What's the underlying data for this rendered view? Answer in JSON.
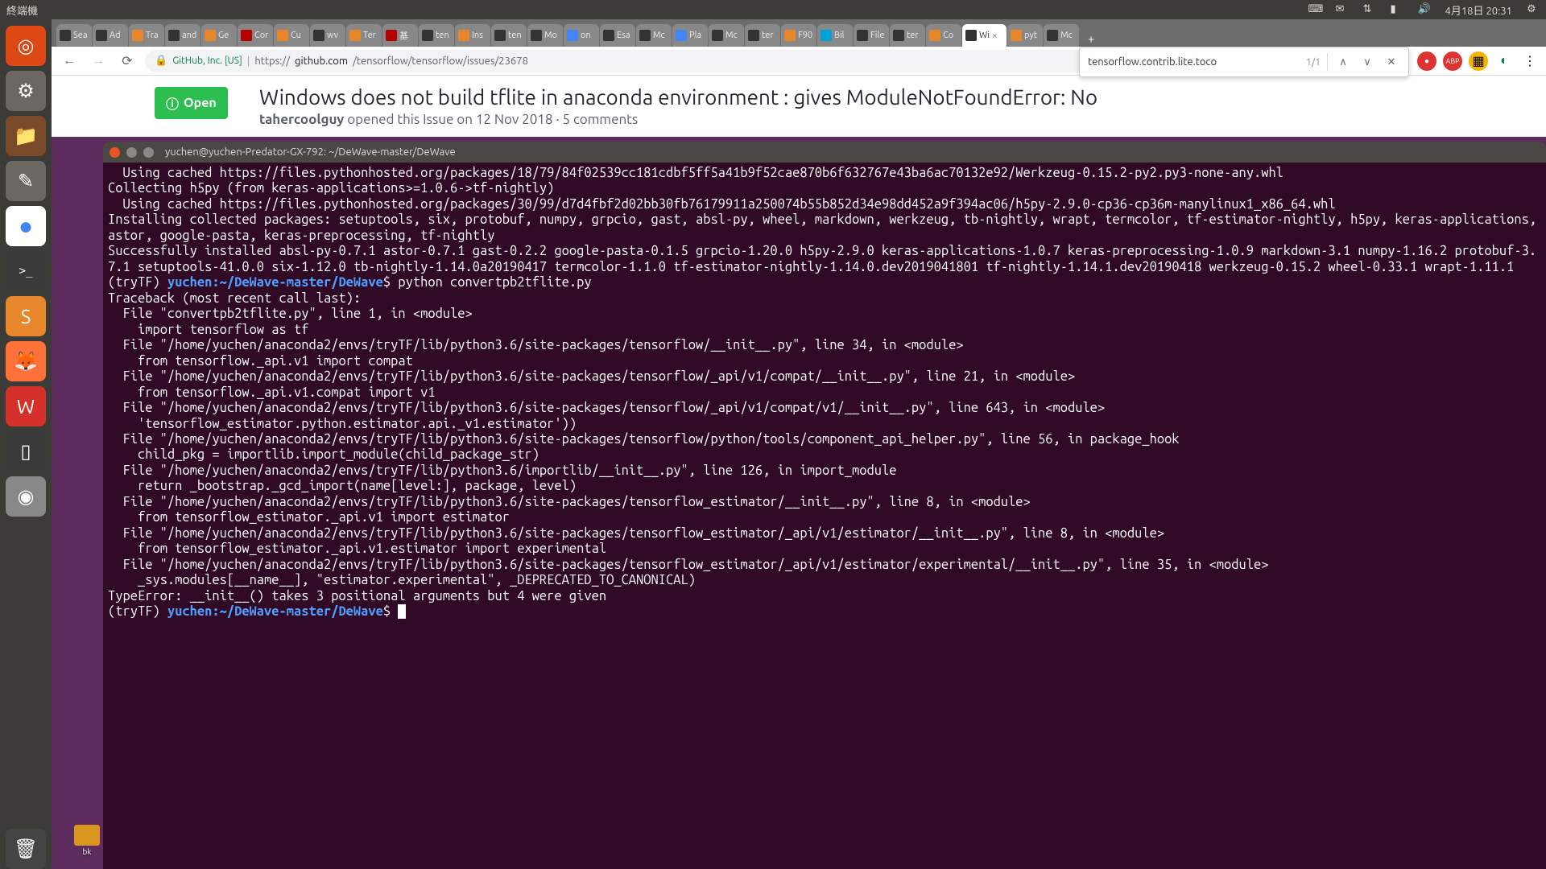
{
  "topbar": {
    "app_title": "終端機",
    "clock": "4月18日 20:31"
  },
  "launcher": {
    "items": [
      {
        "name": "dash",
        "glyph": "◎",
        "bg": "#dd4814"
      },
      {
        "name": "settings",
        "glyph": "⚙",
        "bg": "#6b6763"
      },
      {
        "name": "files",
        "glyph": "📁",
        "bg": "#7a4b2a"
      },
      {
        "name": "gedit",
        "glyph": "✎",
        "bg": "#6b6763"
      },
      {
        "name": "chrome",
        "glyph": "●",
        "bg": "#fff"
      },
      {
        "name": "terminal",
        "glyph": ">_",
        "bg": "#3a3a3a"
      },
      {
        "name": "sublime",
        "glyph": "S",
        "bg": "#e8862b"
      },
      {
        "name": "firefox",
        "glyph": "🦊",
        "bg": "#ff7139"
      },
      {
        "name": "wps",
        "glyph": "W",
        "bg": "#d6302a"
      },
      {
        "name": "device",
        "glyph": "▯",
        "bg": "#3a3a3a"
      },
      {
        "name": "disc",
        "glyph": "◉",
        "bg": "#888"
      }
    ],
    "trash_glyph": "🗑"
  },
  "chrome": {
    "tabs": [
      {
        "label": "Sea",
        "fav": "#333"
      },
      {
        "label": "Ad",
        "fav": "#333"
      },
      {
        "label": "Tra",
        "fav": "#e8862b"
      },
      {
        "label": "and",
        "fav": "#333"
      },
      {
        "label": "Ge",
        "fav": "#e8862b"
      },
      {
        "label": "Cor",
        "fav": "#b30000"
      },
      {
        "label": "Cu",
        "fav": "#e8862b"
      },
      {
        "label": "wv",
        "fav": "#333"
      },
      {
        "label": "Ter",
        "fav": "#e8862b"
      },
      {
        "label": "基",
        "fav": "#b30000"
      },
      {
        "label": "ten",
        "fav": "#333"
      },
      {
        "label": "Ins",
        "fav": "#e8862b"
      },
      {
        "label": "ten",
        "fav": "#333"
      },
      {
        "label": "Mo",
        "fav": "#333"
      },
      {
        "label": "on",
        "fav": "#4285f4"
      },
      {
        "label": "Esa",
        "fav": "#333"
      },
      {
        "label": "Mc",
        "fav": "#333"
      },
      {
        "label": "Pla",
        "fav": "#4285f4"
      },
      {
        "label": "Mc",
        "fav": "#333"
      },
      {
        "label": "ter",
        "fav": "#333"
      },
      {
        "label": "F90",
        "fav": "#e8862b"
      },
      {
        "label": "Bil",
        "fav": "#00a1d6"
      },
      {
        "label": "File",
        "fav": "#333"
      },
      {
        "label": "ter",
        "fav": "#333"
      },
      {
        "label": "Co",
        "fav": "#e8862b"
      },
      {
        "label": "Wi",
        "fav": "#333",
        "active": true
      },
      {
        "label": "pyt",
        "fav": "#e8862b"
      },
      {
        "label": "Mc",
        "fav": "#333"
      }
    ],
    "nav": {
      "back": "←",
      "fwd": "→",
      "reload": "⟳"
    },
    "omnibox": {
      "secure_label": "GitHub, Inc. [US]",
      "url_prefix": "https://",
      "url_host": "github.com",
      "url_path": "/tensorflow/tensorflow/issues/23678"
    },
    "find": {
      "query": "tensorflow.contrib.lite.toco",
      "count": "1/1"
    }
  },
  "github": {
    "status": "Open",
    "title": "Windows does not build tflite in anaconda environment : gives ModuleNotFoundError: No",
    "author": "tahercoolguy",
    "opened": " opened this Issue ",
    "date": "on 12 Nov 2018",
    "comments": " · 5 comments"
  },
  "terminal": {
    "title": "yuchen@yuchen-Predator-GX-792: ~/DeWave-master/DeWave",
    "prompt_env": "(tryTF) ",
    "prompt_userpath": "yuchen:~/DeWave-master/DeWave",
    "prompt_sep": "$ ",
    "cmd1": "python convertpb2tflite.py",
    "lines_pre": [
      "  Using cached https://files.pythonhosted.org/packages/18/79/84f02539cc181cdbf5ff5a41b9f52cae870b6f632767e43ba6ac70132e92/Werkzeug-0.15.2-py2.py3-none-any.whl",
      "Collecting h5py (from keras-applications>=1.0.6->tf-nightly)",
      "  Using cached https://files.pythonhosted.org/packages/30/99/d7d4fbf2d02bb30fb76179911a250074b55b852d34e98dd452a9f394ac06/h5py-2.9.0-cp36-cp36m-manylinux1_x86_64.whl",
      "Installing collected packages: setuptools, six, protobuf, numpy, grpcio, gast, absl-py, wheel, markdown, werkzeug, tb-nightly, wrapt, termcolor, tf-estimator-nightly, h5py, keras-applications, astor, google-pasta, keras-preprocessing, tf-nightly",
      "Successfully installed absl-py-0.7.1 astor-0.7.1 gast-0.2.2 google-pasta-0.1.5 grpcio-1.20.0 h5py-2.9.0 keras-applications-1.0.7 keras-preprocessing-1.0.9 markdown-3.1 numpy-1.16.2 protobuf-3.7.1 setuptools-41.0.0 six-1.12.0 tb-nightly-1.14.0a20190417 termcolor-1.1.0 tf-estimator-nightly-1.14.0.dev2019041801 tf-nightly-1.14.1.dev20190418 werkzeug-0.15.2 wheel-0.33.1 wrapt-1.11.1"
    ],
    "lines_post": [
      "Traceback (most recent call last):",
      "  File \"convertpb2tflite.py\", line 1, in <module>",
      "    import tensorflow as tf",
      "  File \"/home/yuchen/anaconda2/envs/tryTF/lib/python3.6/site-packages/tensorflow/__init__.py\", line 34, in <module>",
      "    from tensorflow._api.v1 import compat",
      "  File \"/home/yuchen/anaconda2/envs/tryTF/lib/python3.6/site-packages/tensorflow/_api/v1/compat/__init__.py\", line 21, in <module>",
      "    from tensorflow._api.v1.compat import v1",
      "  File \"/home/yuchen/anaconda2/envs/tryTF/lib/python3.6/site-packages/tensorflow/_api/v1/compat/v1/__init__.py\", line 643, in <module>",
      "    'tensorflow_estimator.python.estimator.api._v1.estimator'))",
      "  File \"/home/yuchen/anaconda2/envs/tryTF/lib/python3.6/site-packages/tensorflow/python/tools/component_api_helper.py\", line 56, in package_hook",
      "    child_pkg = importlib.import_module(child_package_str)",
      "  File \"/home/yuchen/anaconda2/envs/tryTF/lib/python3.6/importlib/__init__.py\", line 126, in import_module",
      "    return _bootstrap._gcd_import(name[level:], package, level)",
      "  File \"/home/yuchen/anaconda2/envs/tryTF/lib/python3.6/site-packages/tensorflow_estimator/__init__.py\", line 8, in <module>",
      "    from tensorflow_estimator._api.v1 import estimator",
      "  File \"/home/yuchen/anaconda2/envs/tryTF/lib/python3.6/site-packages/tensorflow_estimator/_api/v1/estimator/__init__.py\", line 8, in <module>",
      "    from tensorflow_estimator._api.v1.estimator import experimental",
      "  File \"/home/yuchen/anaconda2/envs/tryTF/lib/python3.6/site-packages/tensorflow_estimator/_api/v1/estimator/experimental/__init__.py\", line 35, in <module>",
      "    _sys.modules[__name__], \"estimator.experimental\", _DEPRECATED_TO_CANONICAL)",
      "TypeError: __init__() takes 3 positional arguments but 4 were given"
    ]
  },
  "desktop": {
    "folder_label": "bk"
  }
}
